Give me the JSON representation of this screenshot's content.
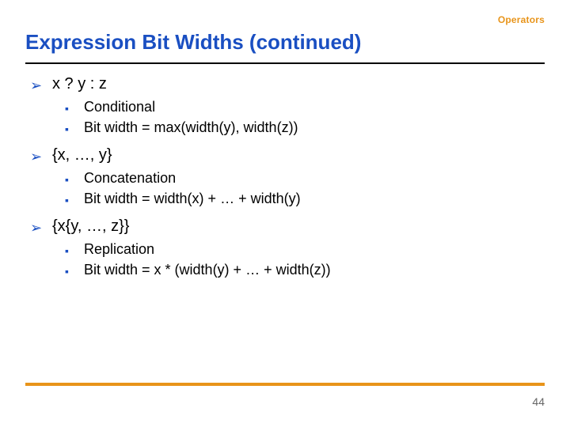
{
  "header": {
    "topic": "Operators",
    "title": "Expression Bit Widths (continued)"
  },
  "bullets": {
    "item1": {
      "text": "x ? y : z",
      "sub1": "Conditional",
      "sub2": "Bit width = max(width(y), width(z))"
    },
    "item2": {
      "text": "{x, …, y}",
      "sub1": "Concatenation",
      "sub2": "Bit width = width(x) + … + width(y)"
    },
    "item3": {
      "text": "{x{y, …, z}}",
      "sub1": "Replication",
      "sub2": "Bit width = x * (width(y) + … + width(z))"
    }
  },
  "footer": {
    "page_number": "44"
  },
  "glyphs": {
    "arrow": "➢",
    "square": "▪"
  }
}
